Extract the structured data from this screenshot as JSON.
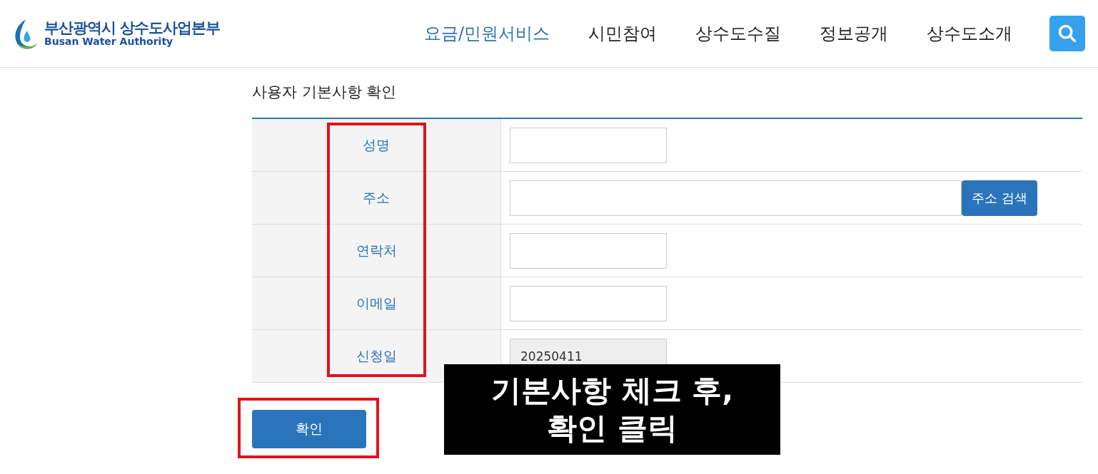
{
  "logo": {
    "title": "부산광역시 상수도사업본부",
    "subtitle": "Busan Water Authority"
  },
  "nav": [
    {
      "label": "요금/민원서비스",
      "selected": true
    },
    {
      "label": "시민참여",
      "selected": false
    },
    {
      "label": "상수도수질",
      "selected": false
    },
    {
      "label": "정보공개",
      "selected": false
    },
    {
      "label": "상수도소개",
      "selected": false
    }
  ],
  "section_title": "사용자 기본사항 확인",
  "form": [
    {
      "label": "성명",
      "kind": "short",
      "disabled": false
    },
    {
      "label": "주소",
      "kind": "address",
      "disabled": false,
      "button": "주소 검색"
    },
    {
      "label": "연락처",
      "kind": "short",
      "disabled": false
    },
    {
      "label": "이메일",
      "kind": "short",
      "disabled": false
    },
    {
      "label": "신청일",
      "kind": "short",
      "disabled": true,
      "value": "20250411"
    }
  ],
  "confirm_button": "확인",
  "caption": [
    "기본사항 체크 후,",
    "확인 클릭"
  ]
}
